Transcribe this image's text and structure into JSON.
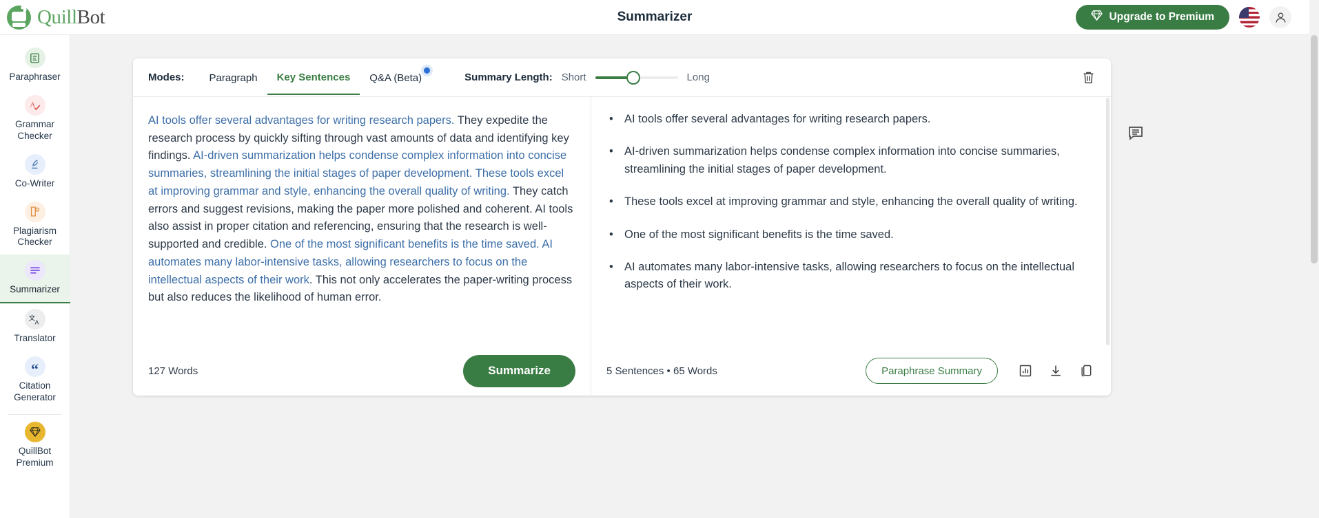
{
  "header": {
    "logo_text_a": "Quill",
    "logo_text_b": "Bot",
    "title": "Summarizer",
    "upgrade_label": "Upgrade to Premium",
    "upgrade_color": "#3a7d44",
    "flag": "us-flag-icon",
    "avatar": "user-avatar-icon"
  },
  "sidebar": {
    "items": [
      {
        "label": "Paraphraser",
        "icon": "paraphraser-icon",
        "icon_bg": "#e6f2e6",
        "icon_color": "#3a7d44",
        "glyph": "≡",
        "active": false
      },
      {
        "label": "Grammar Checker",
        "icon": "grammar-checker-icon",
        "icon_bg": "#fdeaea",
        "icon_color": "#d9534f",
        "glyph": "A",
        "active": false
      },
      {
        "label": "Co-Writer",
        "icon": "co-writer-icon",
        "icon_bg": "#e6effb",
        "icon_color": "#3d6fa8",
        "glyph": "✎",
        "active": false
      },
      {
        "label": "Plagiarism Checker",
        "icon": "plagiarism-checker-icon",
        "icon_bg": "#fdf0e3",
        "icon_color": "#e08b3a",
        "glyph": "⌕",
        "active": false
      },
      {
        "label": "Summarizer",
        "icon": "summarizer-icon",
        "icon_bg": "#ece7fb",
        "icon_color": "#7a4fe0",
        "glyph": "☰",
        "active": true
      },
      {
        "label": "Translator",
        "icon": "translator-icon",
        "icon_bg": "#ededed",
        "icon_color": "#1c2b3a",
        "glyph": "文",
        "active": false
      },
      {
        "label": "Citation Generator",
        "icon": "citation-generator-icon",
        "icon_bg": "#e6effb",
        "icon_color": "#2b4f8e",
        "glyph": "“",
        "active": false
      }
    ],
    "premium": {
      "label": "QuillBot Premium",
      "icon": "premium-diamond-icon",
      "icon_bg": "#e8b730",
      "glyph": "◆"
    }
  },
  "toolbar": {
    "modes_label": "Modes:",
    "tabs": [
      {
        "label": "Paragraph",
        "active": false,
        "badge": false
      },
      {
        "label": "Key Sentences",
        "active": true,
        "badge": false
      },
      {
        "label": "Q&A (Beta)",
        "active": false,
        "badge": true
      }
    ],
    "summary_length_label": "Summary Length:",
    "short_label": "Short",
    "long_label": "Long",
    "slider_value": 45,
    "delete_icon": "trash-icon",
    "feedback_icon": "feedback-comment-icon"
  },
  "input_panel": {
    "segments": [
      {
        "text": "AI tools offer several advantages for writing research papers. ",
        "highlight": true
      },
      {
        "text": "They expedite the research process by quickly sifting through vast amounts of data and identifying key findings. ",
        "highlight": false
      },
      {
        "text": "AI-driven summarization helps condense complex information into concise summaries, streamlining the initial stages of paper development. These tools excel at improving grammar and style, enhancing the overall quality of writing.",
        "highlight": true
      },
      {
        "text": " They catch errors and suggest revisions, making the paper more polished and coherent. AI tools also assist in proper citation and referencing, ensuring that the research is well-supported and credible. ",
        "highlight": false
      },
      {
        "text": "One of the most significant benefits is the time saved. AI automates many labor-intensive tasks, allowing researchers to focus on the intellectual aspects of their work",
        "highlight": true
      },
      {
        "text": ". This not only accelerates the paper-writing process but also reduces the likelihood of human error.",
        "highlight": false
      }
    ],
    "word_count": "127 Words",
    "summarize_label": "Summarize"
  },
  "output_panel": {
    "bullets": [
      "AI tools offer several advantages for writing research papers.",
      "AI-driven summarization helps condense complex information into concise summaries, streamlining the initial stages of paper development.",
      "These tools excel at improving grammar and style, enhancing the overall quality of writing.",
      " One of the most significant benefits is the time saved.",
      "AI automates many labor-intensive tasks, allowing researchers to focus on the intellectual aspects of their work."
    ],
    "stats": "5 Sentences • 65 Words",
    "paraphrase_label": "Paraphrase Summary",
    "icons": [
      "bar-chart-icon",
      "download-icon",
      "copy-icon"
    ]
  }
}
